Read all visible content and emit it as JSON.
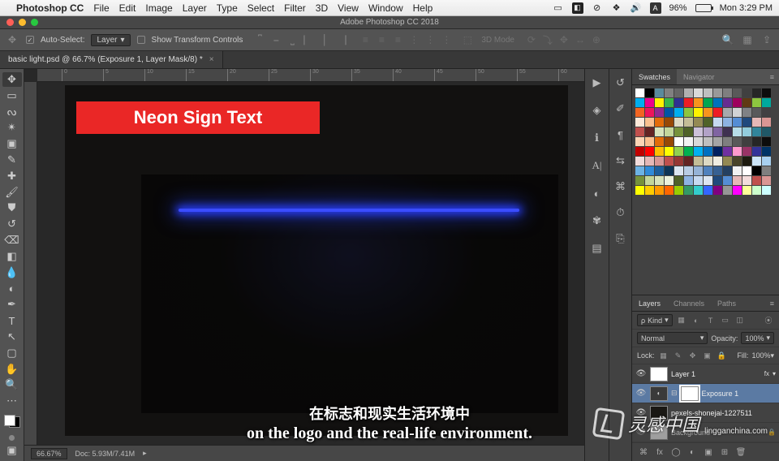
{
  "menubar": {
    "apple": "",
    "app": "Photoshop CC",
    "items": [
      "File",
      "Edit",
      "Image",
      "Layer",
      "Type",
      "Select",
      "Filter",
      "3D",
      "View",
      "Window",
      "Help"
    ],
    "battery_pct": "96%",
    "clock": "Mon 3:29 PM"
  },
  "window": {
    "title": "Adobe Photoshop CC 2018"
  },
  "options": {
    "auto_select_label": "Auto-Select:",
    "target": "Layer",
    "show_transform": "Show Transform Controls",
    "mode_3d": "3D Mode"
  },
  "doc_tab": {
    "title": "basic light.psd @ 66.7% (Exposure 1, Layer Mask/8) *"
  },
  "ruler_ticks": [
    "0",
    "5",
    "10",
    "15",
    "20",
    "25",
    "30",
    "35",
    "40",
    "45",
    "50",
    "55",
    "60"
  ],
  "banner": {
    "text": "Neon Sign Text"
  },
  "swatches_tabs": {
    "a": "Swatches",
    "b": "Navigator"
  },
  "swatch_colors": [
    "#ffffff",
    "#000000",
    "#5a8a9c",
    "#808080",
    "#666666",
    "#b0b0b0",
    "#d9d9d9",
    "#bfbfbf",
    "#999999",
    "#7f7f7f",
    "#595959",
    "#404040",
    "#262626",
    "#0d0d0d",
    "#00aeef",
    "#ec008c",
    "#fff200",
    "#39b54a",
    "#2e3192",
    "#ed1c24",
    "#f7941d",
    "#00a651",
    "#0072bc",
    "#662d91",
    "#9e005d",
    "#603913",
    "#8dc63f",
    "#00a99d",
    "#f26522",
    "#ed145b",
    "#92278f",
    "#0054a6",
    "#00aeef",
    "#8dc63f",
    "#fff200",
    "#f7941d",
    "#ed1c24",
    "#a7a9ac",
    "#d1d3d4",
    "#808285",
    "#58595b",
    "#414042",
    "#fde9d9",
    "#fac08f",
    "#e36c09",
    "#974806",
    "#ddd9c3",
    "#c4bd97",
    "#948a54",
    "#4f6228",
    "#c6d9f0",
    "#8db3e2",
    "#548dd4",
    "#1f497d",
    "#e5b8b7",
    "#d99694",
    "#c0504d",
    "#632423",
    "#d7e3bc",
    "#c3d69b",
    "#76923c",
    "#4f6228",
    "#ccc1d9",
    "#b2a2c7",
    "#8064a2",
    "#3f3151",
    "#b7dde8",
    "#92cddc",
    "#31859b",
    "#205867",
    "#fbd5b5",
    "#fac08f",
    "#e36c09",
    "#974806",
    "#ffffff",
    "#f2f2f2",
    "#d8d8d8",
    "#bfbfbf",
    "#a5a5a5",
    "#7f7f7f",
    "#595959",
    "#3f3f3f",
    "#262626",
    "#0c0c0c",
    "#c00000",
    "#ff0000",
    "#ffc000",
    "#ffff00",
    "#92d050",
    "#00b050",
    "#00b0f0",
    "#0070c0",
    "#002060",
    "#7030a0",
    "#ff99cc",
    "#993366",
    "#333399",
    "#003366",
    "#f2dcdb",
    "#e5b8b7",
    "#d99694",
    "#c0504d",
    "#953734",
    "#632423",
    "#c4bd97",
    "#ddd9c3",
    "#eeece1",
    "#938953",
    "#494429",
    "#1d1b10",
    "#cce4f7",
    "#a8d0f0",
    "#6cb2e4",
    "#2f8ad8",
    "#1c5e9b",
    "#0f3556",
    "#dbe5f1",
    "#b8cce4",
    "#95b3d7",
    "#4f81bd",
    "#366092",
    "#244061",
    "#f2f2f2",
    "#ffffff",
    "#000000",
    "#7f7f7f",
    "#76923c",
    "#c3d69b",
    "#d7e3bc",
    "#ebf1dd",
    "#4f6228",
    "#8db3e2",
    "#c6d9f0",
    "#dbe5f1",
    "#1f497d",
    "#548dd4",
    "#e5b8b7",
    "#f2dcdb",
    "#c0504d",
    "#d99694",
    "#ffff00",
    "#ffcc00",
    "#ff9900",
    "#ff6600",
    "#99cc00",
    "#339966",
    "#33cccc",
    "#3366ff",
    "#800080",
    "#969696",
    "#ff00ff",
    "#ffff99",
    "#ccffcc",
    "#ccffff"
  ],
  "layers_panel": {
    "tabs": {
      "a": "Layers",
      "b": "Channels",
      "c": "Paths"
    },
    "kind_label": "Kind",
    "blend_mode": "Normal",
    "opacity_label": "Opacity:",
    "opacity_value": "100%",
    "lock_label": "Lock:",
    "fill_label": "Fill:",
    "fill_value": "100%",
    "layers": [
      {
        "name": "Layer 1",
        "fx": "fx"
      },
      {
        "name": "Exposure 1"
      },
      {
        "name": "pexels-shonejai-1227511"
      },
      {
        "name": "Background"
      }
    ]
  },
  "status": {
    "zoom": "66.67%",
    "doc": "Doc: 5.93M/7.41M"
  },
  "captions": {
    "zh": "在标志和现实生活环境中",
    "en": "on the logo and the real-life environment."
  },
  "watermark": {
    "text": "灵感中国",
    "sub": "lingganchina.com"
  },
  "tools": [
    "move",
    "marquee",
    "lasso",
    "wand",
    "crop",
    "eyedrop",
    "patch",
    "brush",
    "stamp",
    "history",
    "eraser",
    "gradient",
    "blur",
    "dodge",
    "pen",
    "type",
    "path",
    "rect",
    "hand",
    "zoom",
    "more"
  ],
  "vdock_icons": [
    "play",
    "cube",
    "info",
    "text-style",
    "contrast",
    "butterfly",
    "grid"
  ],
  "vdock2_icons": [
    "history",
    "brush-preset",
    "char",
    "swap",
    "cc",
    "timeline",
    "share"
  ]
}
